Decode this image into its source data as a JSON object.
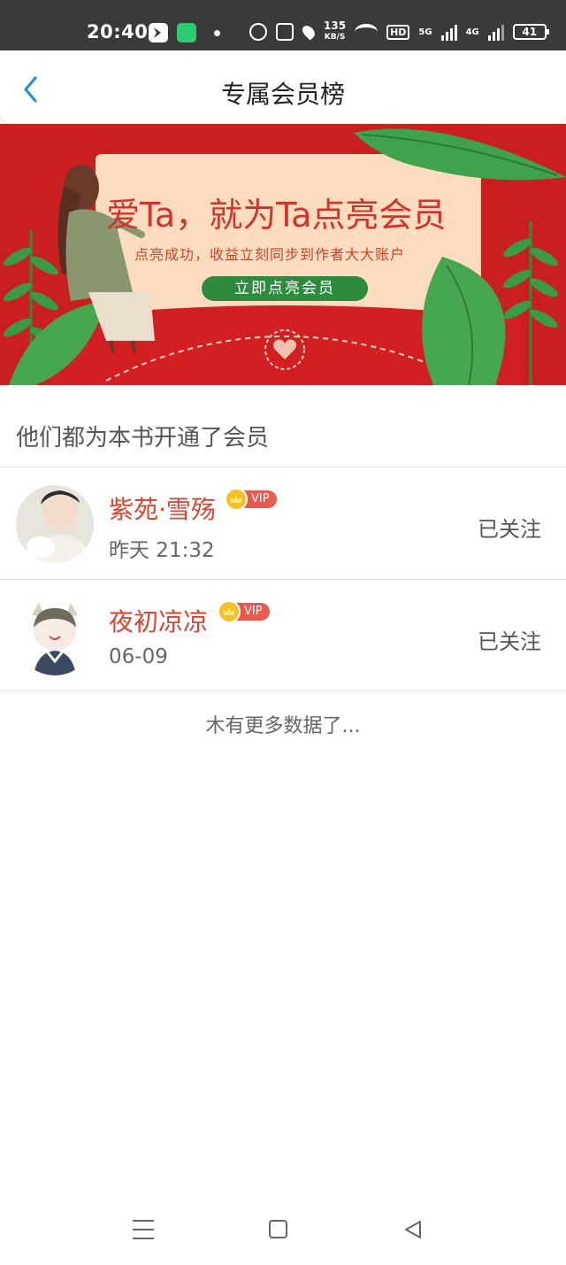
{
  "status_bar": {
    "time": "20:40",
    "speed_value": "135",
    "speed_unit": "KB/S",
    "hd": "HD",
    "net1": "5G",
    "net2": "4G",
    "battery": "41"
  },
  "header": {
    "title": "专属会员榜",
    "back_icon": "chevron-left-icon"
  },
  "banner": {
    "title": "爱Ta，就为Ta点亮会员",
    "subtitle": "点亮成功，收益立刻同步到作者大大账户",
    "button_label": "立即点亮会员"
  },
  "section": {
    "title": "他们都为本书开通了会员"
  },
  "members": [
    {
      "name": "紫苑·雪殇",
      "vip_label": "VIP",
      "time": "昨天 21:32",
      "follow_status": "已关注"
    },
    {
      "name": "夜初凉凉",
      "vip_label": "VIP",
      "time": "06-09",
      "follow_status": "已关注"
    }
  ],
  "footer": {
    "no_more": "木有更多数据了..."
  },
  "colors": {
    "accent_blue": "#2b8fd9",
    "name_red": "#d9452f",
    "vip_red": "#e85a4f",
    "banner_red": "#c9201f"
  }
}
